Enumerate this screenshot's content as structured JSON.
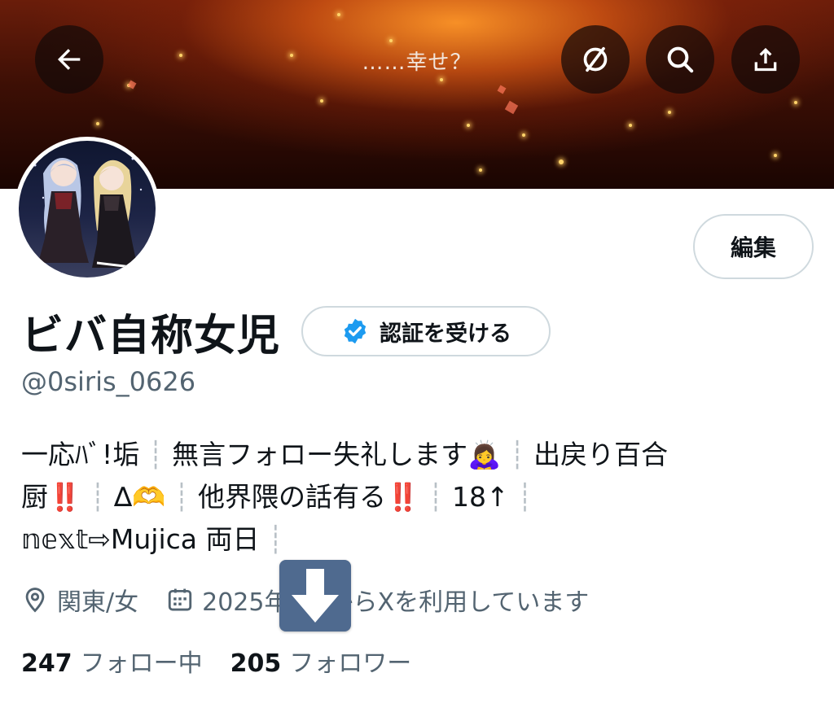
{
  "header": {
    "title": "……幸せ？",
    "back_icon": "arrow-left-icon",
    "mute_icon": "circle-slash-icon",
    "search_icon": "search-icon",
    "share_icon": "share-icon"
  },
  "profile": {
    "edit_label": "編集",
    "display_name": "ビバ自称女児",
    "verify_label": "認証を受ける",
    "handle": "@0siris_0626"
  },
  "bio": {
    "line1": {
      "a": "一応ﾊﾞ!垢",
      "sep1": "┊",
      "b": "無言フォロー失礼します🙇‍♀️",
      "sep2": "┊",
      "c": "出戻り百合"
    },
    "line2": {
      "a": "厨",
      "bang1": "‼️",
      "sep1": "┊",
      "b": "∆🫶",
      "sep2": "┊",
      "c": "他界隈の話有る",
      "bang2": "‼️",
      "sep3": "┊",
      "d": "18↑",
      "sep4": "┊"
    },
    "line3": {
      "a": "𝕟𝕖𝕩𝕥⇨Mujica 両日",
      "sep1": "┊"
    }
  },
  "meta": {
    "location": "関東/女",
    "joined": "2025年6月からXを利用しています",
    "location_icon": "map-pin-icon",
    "calendar_icon": "calendar-icon"
  },
  "stats": {
    "following_count": "247",
    "following_label": "フォロー中",
    "followers_count": "205",
    "followers_label": "フォロワー"
  },
  "colors": {
    "text": "#0f1419",
    "secondary": "#536471",
    "border": "#cfd9de",
    "verified": "#1d9bf0",
    "alert_red": "#e0282e",
    "overlay": "#4f6a8f"
  }
}
